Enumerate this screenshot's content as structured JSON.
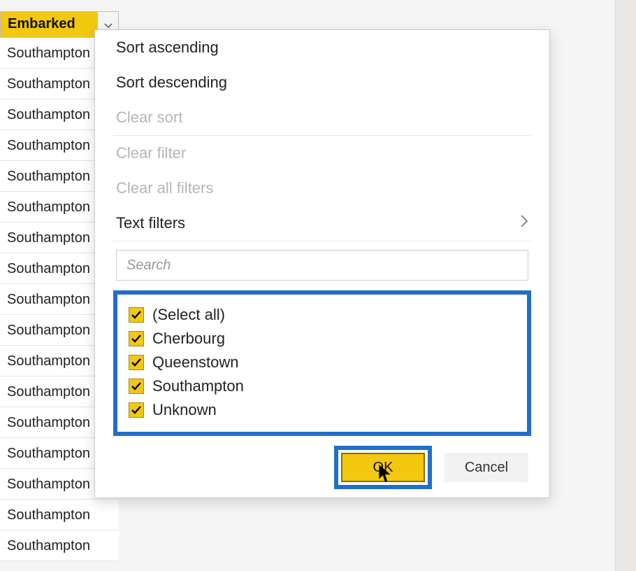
{
  "column": {
    "header": "Embarked",
    "cells": [
      "Southampton",
      "Southampton",
      "Southampton",
      "Southampton",
      "Southampton",
      "Southampton",
      "Southampton",
      "Southampton",
      "Southampton",
      "Southampton",
      "Southampton",
      "Southampton",
      "Southampton",
      "Southampton",
      "Southampton",
      "Southampton",
      "Southampton"
    ]
  },
  "menu": {
    "sort_asc": "Sort ascending",
    "sort_desc": "Sort descending",
    "clear_sort": "Clear sort",
    "clear_filter": "Clear filter",
    "clear_all_filters": "Clear all filters",
    "text_filters": "Text filters",
    "search_placeholder": "Search"
  },
  "filter": {
    "items": [
      {
        "label": "(Select all)",
        "checked": true
      },
      {
        "label": "Cherbourg",
        "checked": true
      },
      {
        "label": "Queenstown",
        "checked": true
      },
      {
        "label": "Southampton",
        "checked": true
      },
      {
        "label": "Unknown",
        "checked": true
      }
    ]
  },
  "buttons": {
    "ok": "OK",
    "cancel": "Cancel"
  }
}
